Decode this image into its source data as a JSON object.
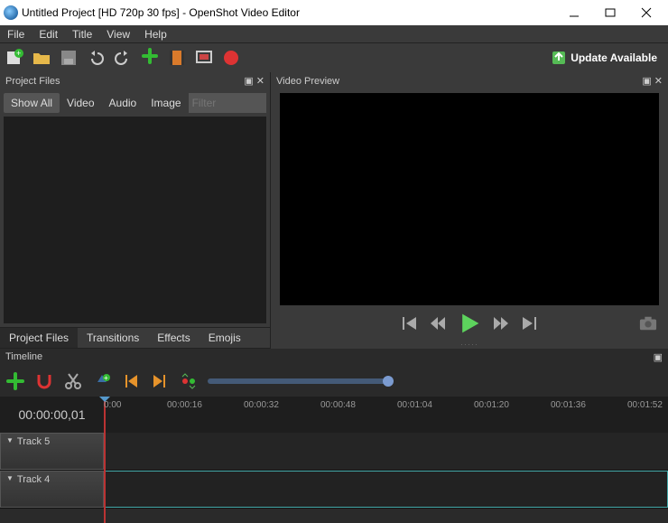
{
  "title": "Untitled Project [HD 720p 30 fps] - OpenShot Video Editor",
  "menu": [
    "File",
    "Edit",
    "Title",
    "View",
    "Help"
  ],
  "update": "Update Available",
  "panels": {
    "project": "Project Files",
    "preview": "Video Preview",
    "timeline": "Timeline"
  },
  "filters": {
    "showAll": "Show All",
    "video": "Video",
    "audio": "Audio",
    "image": "Image",
    "placeholder": "Filter"
  },
  "tabs": [
    "Project Files",
    "Transitions",
    "Effects",
    "Emojis"
  ],
  "timecode": "00:00:00,01",
  "ruler": [
    "0:00",
    "00:00:16",
    "00:00:32",
    "00:00:48",
    "00:01:04",
    "00:01:20",
    "00:01:36",
    "00:01:52"
  ],
  "tracks": [
    "Track 5",
    "Track 4"
  ]
}
